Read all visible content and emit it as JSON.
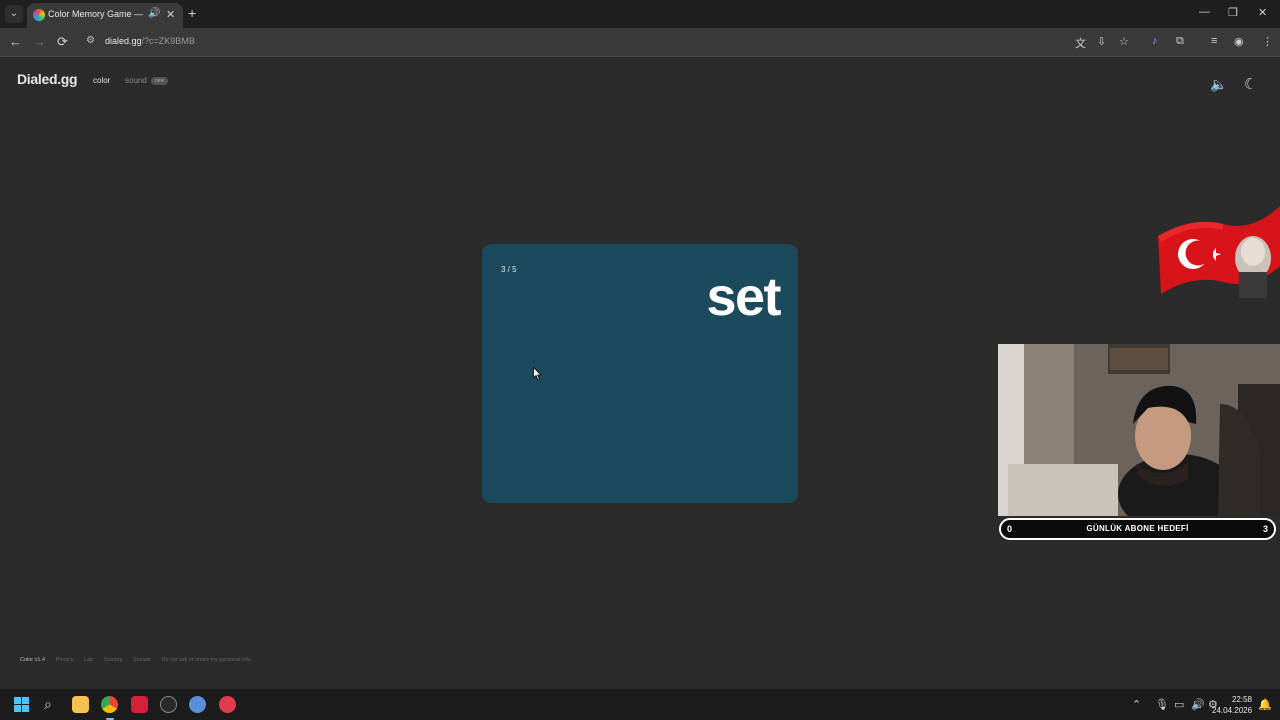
{
  "browser": {
    "tab": {
      "title": "Color Memory Game — Ho",
      "audio_icon": "speaker-icon",
      "close": "✕"
    },
    "new_tab": "+",
    "window_controls": {
      "minimize": "—",
      "restore": "❐",
      "close": "✕"
    },
    "nav": {
      "back": "←",
      "forward": "→",
      "reload": "⟳"
    },
    "address": {
      "host": "dialed.gg",
      "query": "/?c=ZK9BMB"
    }
  },
  "site": {
    "logo": "Dialed.gg",
    "nav_color": "color",
    "nav_sound": "sound",
    "sound_badge": "new",
    "sound_toggle": "🔈",
    "theme_toggle": "☾"
  },
  "game": {
    "counter": "3 / 5",
    "word": "set",
    "card_color": "#1c4a5d"
  },
  "stream_overlay": {
    "goal_current": "0",
    "goal_title": "GÜNLÜK ABONE HEDEFİ",
    "goal_target": "3"
  },
  "footer": {
    "version": "Color v1.4",
    "links": [
      "Privacy",
      "Lab",
      "Scoring",
      "Socials",
      "Do not sell or share my personal info"
    ]
  },
  "taskbar": {
    "time": "22:58",
    "date": "24.04.2026"
  }
}
